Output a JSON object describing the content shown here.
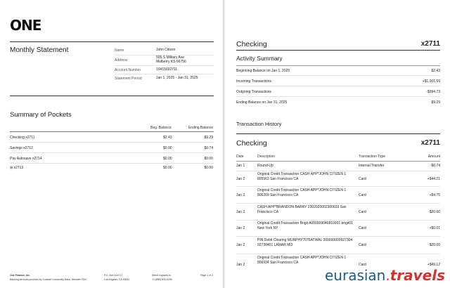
{
  "brand": {
    "logo": "ONE"
  },
  "statement": {
    "title": "Monthly Statement",
    "info": [
      {
        "label": "Name",
        "value": "John Citizen"
      },
      {
        "label": "Address",
        "value": "505 S Military Ave\nMulberry KS 66756"
      },
      {
        "label": "Account Number",
        "value": "10415032711"
      },
      {
        "label": "Statement Period",
        "value": "Jan 1, 2025 - Jan 31, 2025"
      }
    ]
  },
  "pockets": {
    "title": "Summary of Pockets",
    "col_begin": "Beg. Balance",
    "col_end": "Ending Balance",
    "rows": [
      {
        "name": "Checking  x2711",
        "begin": "$2.43",
        "end": "$9.29"
      },
      {
        "name": "Savings  x2712",
        "begin": "$0.00",
        "end": "$0.74"
      },
      {
        "name": "Pay Autosave  x2714",
        "begin": "$0.00",
        "end": "$0.00"
      },
      {
        "name": "⊞  x2713",
        "begin": "$0.00",
        "end": "$0.00"
      }
    ]
  },
  "footer": {
    "company": "One Finance, Inc.",
    "disclosure": "Banking services provided by Coastal Community Bank, Member FDIC",
    "po_box": "P.O. Box 513717",
    "city": "Los Angeles, CA 90051",
    "inquiries": "Direct inquiries to",
    "phone": "+1 (855) 830-6250",
    "page": "Page 1 of 2"
  },
  "checking": {
    "title": "Checking",
    "account": "x2711",
    "activity_title": "Activity Summary",
    "summary": [
      {
        "label": "Beginning Balance on Jan 1, 2025",
        "value": "$2.43"
      },
      {
        "label": "Incoming Transactions",
        "value": "+$1,001.59"
      },
      {
        "label": "Outgoing Transactions",
        "value": "-$994.73"
      },
      {
        "label": "Ending Balance on Jan 31, 2025",
        "value": "$9.29"
      }
    ],
    "history_title": "Transaction History",
    "table_title": "Checking",
    "table_account": "x2711",
    "columns": {
      "date": "Date",
      "description": "Description",
      "type": "Transaction Type",
      "amount": "Amount"
    },
    "transactions": [
      {
        "date": "Jan 1",
        "description": "Round-Up",
        "type": "Internal Transfer",
        "amount": "-$0.74"
      },
      {
        "date": "Jan 2",
        "description": "Original Credit Transaction CASH APP*JOHN CITIZEN 1 805563 San Francisco CA",
        "type": "Card",
        "amount": "+$44.21"
      },
      {
        "date": "Jan 2",
        "description": "Original Credit Transaction CASH APP*JOHN CITIZEN 1 806269 San Francisco CA",
        "type": "Card",
        "amount": "+$4.75"
      },
      {
        "date": "Jan 2",
        "description": "CASH APP*BRANDON BARRY 2302020002300033 San Francisco CA",
        "type": "Card",
        "amount": "-$20.00"
      },
      {
        "date": "Jan 2",
        "description": "Original Credit Transaction Brigit A000009040810001 brigit01 New York NY",
        "type": "Card",
        "amount": "+$0.01"
      },
      {
        "date": "Jan 2",
        "description": "PIN Debit Clearing MURPHY7076ATWAL 000000000927304 92730401 LAMAR MO",
        "type": "Card",
        "amount": "-$20.00"
      },
      {
        "date": "Jan 2",
        "description": "Original Credit Transaction CASH APP*JOHN CITIZEN 1 806934 San Francisco CA",
        "type": "Card",
        "amount": "+$49.12"
      }
    ]
  },
  "watermark": {
    "name": "eurasian",
    "dot": ".",
    "tld": "travels"
  }
}
